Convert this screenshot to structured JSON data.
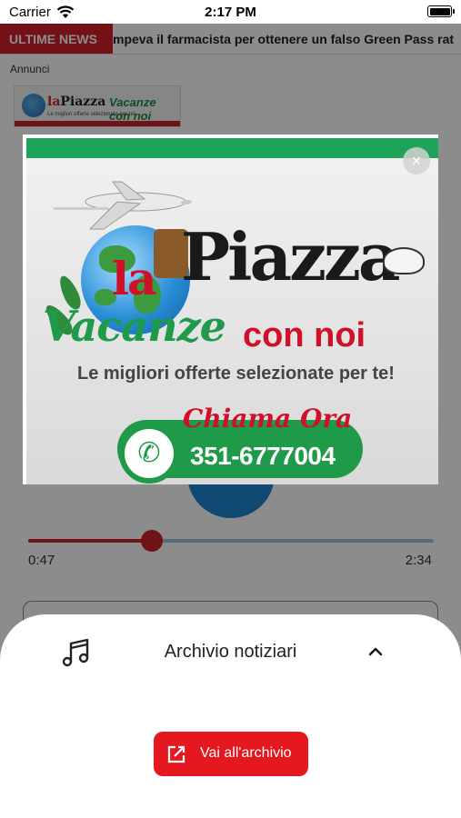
{
  "status_bar": {
    "carrier": "Carrier",
    "time": "2:17 PM",
    "wifi_icon": "wifi-icon",
    "battery_icon": "battery-icon"
  },
  "ticker": {
    "label": "ULTIME NEWS",
    "text": "mpeva il farmacista per ottenere un falso Green Pass rat"
  },
  "ads_label": "Annunci",
  "ad_small_banner": {
    "brand_la": "la",
    "brand_piazza": "Piazza",
    "brand_tail": "Vacanze con noi",
    "tagline": "Le migliori offerte selezionate per te!"
  },
  "player": {
    "current_time": "0:47",
    "total_time": "2:34",
    "progress": 0.305
  },
  "ad_modal": {
    "close_glyph": "×",
    "brand_la": "la",
    "brand_piazza": "Piazza",
    "vacanze": "Vacanze",
    "con_noi": "con noi",
    "tagline": "Le migliori offerte selezionate per te!",
    "call_to_action": "Chiama Ora",
    "phone": "351-6777004",
    "phone_icon": "phone-icon",
    "close_icon": "close-icon"
  },
  "sheet": {
    "icon": "music-note-icon",
    "title": "Archivio notiziari",
    "chevron_icon": "chevron-up-icon",
    "button_icon": "external-link-icon",
    "button_label": "Vai all'archivio"
  },
  "colors": {
    "brand_red": "#e5171f",
    "ticker_red": "#d3202a",
    "ad_green": "#1ea35a",
    "track_blue": "#9ec3e4"
  }
}
